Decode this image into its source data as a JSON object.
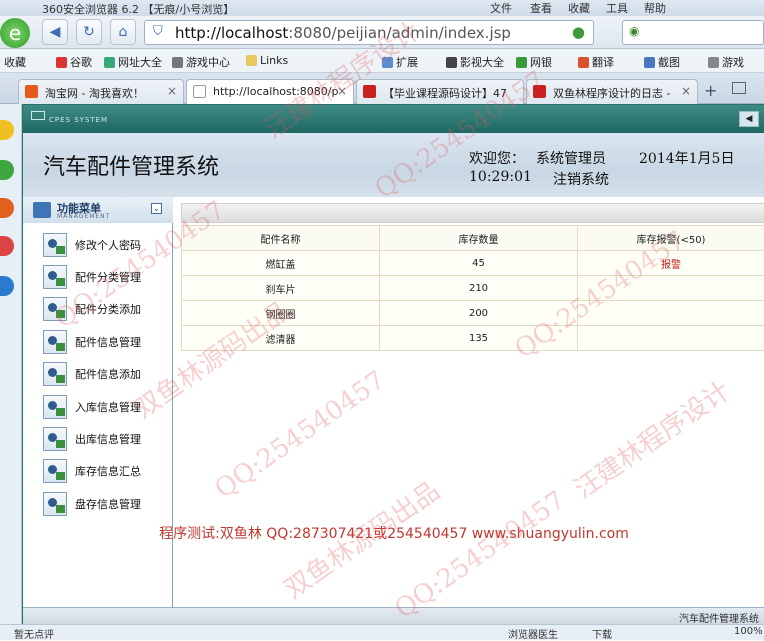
{
  "browser": {
    "title": "360安全浏览器 6.2 【无痕/小号浏览】",
    "menu": [
      "文件",
      "查看",
      "收藏",
      "工具",
      "帮助"
    ],
    "url_host": "http://localhost",
    "url_path": ":8080/peijian/admin/index.jsp",
    "favorites": [
      "收藏",
      "谷歌",
      "网址大全",
      "游戏中心",
      "Links",
      "扩展",
      "影视大全",
      "网银",
      "翻译",
      "截图",
      "游戏"
    ],
    "tabs": [
      {
        "label": "淘宝网 - 淘我喜欢！",
        "active": false
      },
      {
        "label": "http://localhost:8080/p",
        "active": true
      },
      {
        "label": "【毕业课程源码设计】47",
        "active": false
      },
      {
        "label": "双鱼林程序设计的日志 -",
        "active": false
      }
    ],
    "status_left": "暂无点评",
    "status_items": [
      "浏览器医生",
      "下载",
      "100%"
    ]
  },
  "app": {
    "brand": "CPES SYSTEM",
    "title": "汽车配件管理系统",
    "welcome": "欢迎您：",
    "user": "系统管理员",
    "date": "2014年1月5日",
    "time": "10:29:01",
    "logout": "注销系统",
    "footer": "汽车配件管理系统"
  },
  "sidebar": {
    "title": "功能菜单",
    "subtitle": "MANAGEMENT",
    "items": [
      "修改个人密码",
      "配件分类管理",
      "配件分类添加",
      "配件信息管理",
      "配件信息添加",
      "入库信息管理",
      "出库信息管理",
      "库存信息汇总",
      "盘存信息管理"
    ]
  },
  "table": {
    "headers": [
      "配件名称",
      "库存数量",
      "库存报警(<50)"
    ],
    "rows": [
      [
        "燃缸盖",
        "45",
        "报警"
      ],
      [
        "刹车片",
        "210",
        ""
      ],
      [
        "钢圈圈",
        "200",
        ""
      ],
      [
        "滤清器",
        "135",
        ""
      ]
    ]
  },
  "credit": "程序测试:双鱼林 QQ:287307421或254540457 www.shuangyulin.com",
  "watermarks": [
    "QQ:254540457",
    "汪建林程序设计",
    "双鱼林源码出品"
  ]
}
